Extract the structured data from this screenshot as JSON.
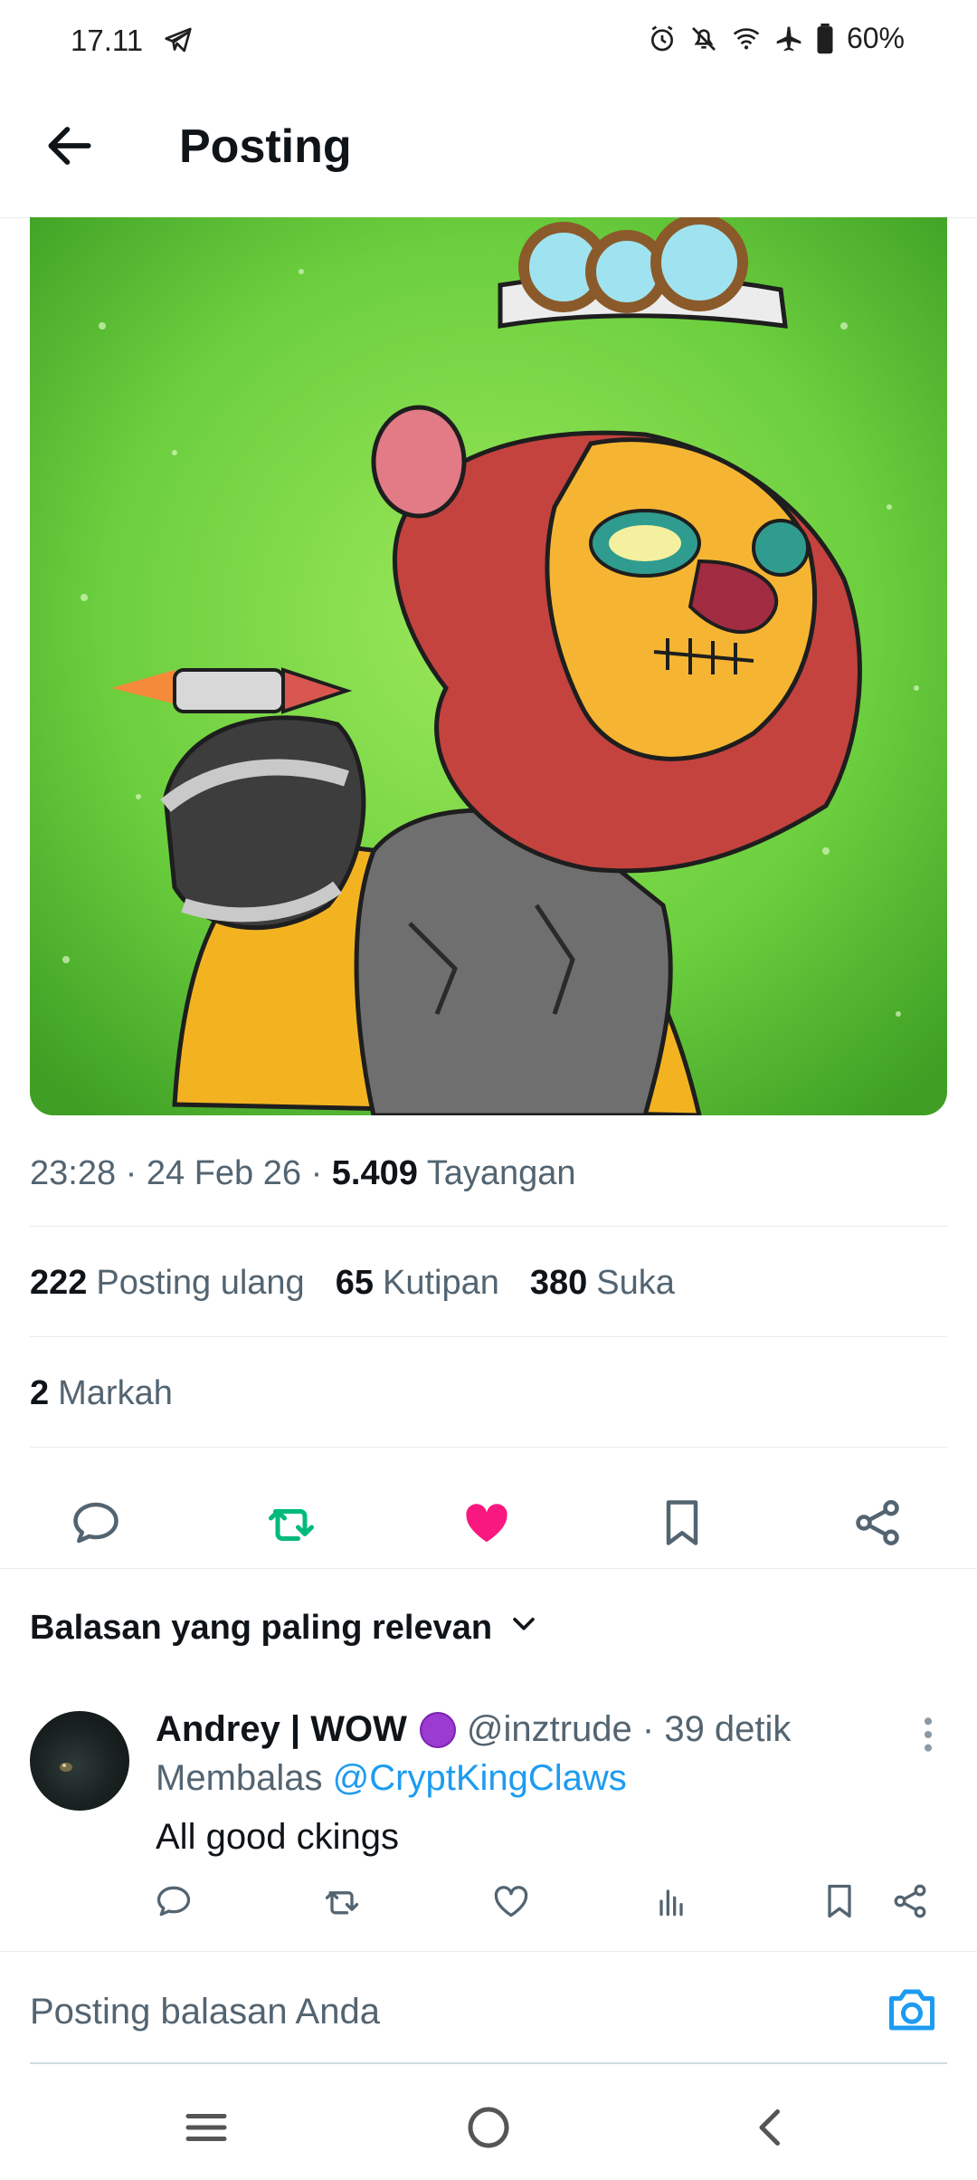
{
  "status_bar": {
    "time": "17.11",
    "battery": "60%",
    "icons": [
      "telegram-icon",
      "alarm-icon",
      "mute-icon",
      "wifi-icon",
      "airplane-icon",
      "battery-icon"
    ]
  },
  "header": {
    "title": "Posting"
  },
  "post": {
    "time": "23:28",
    "date": "24 Feb 26",
    "views_count": "5.409",
    "views_label": "Tayangan",
    "reposts_count": "222",
    "reposts_label": "Posting ulang",
    "quotes_count": "65",
    "quotes_label": "Kutipan",
    "likes_count": "380",
    "likes_label": "Suka",
    "bookmarks_count": "2",
    "bookmarks_label": "Markah"
  },
  "colors": {
    "accent": "#1d9bf0",
    "repost_green": "#00ba7c",
    "like_pink": "#f91880",
    "muted_text": "#536471",
    "image_bg_green": "#6ccf3e"
  },
  "replies": {
    "sort_label": "Balasan yang paling relevan",
    "items": [
      {
        "name": "Andrey | WOW",
        "handle": "@inztrude",
        "time": "39 detik",
        "replying_prefix": "Membalas",
        "replying_to": "@CryptKingClaws",
        "text": "All good ckings"
      }
    ]
  },
  "compose": {
    "placeholder": "Posting balasan Anda"
  }
}
